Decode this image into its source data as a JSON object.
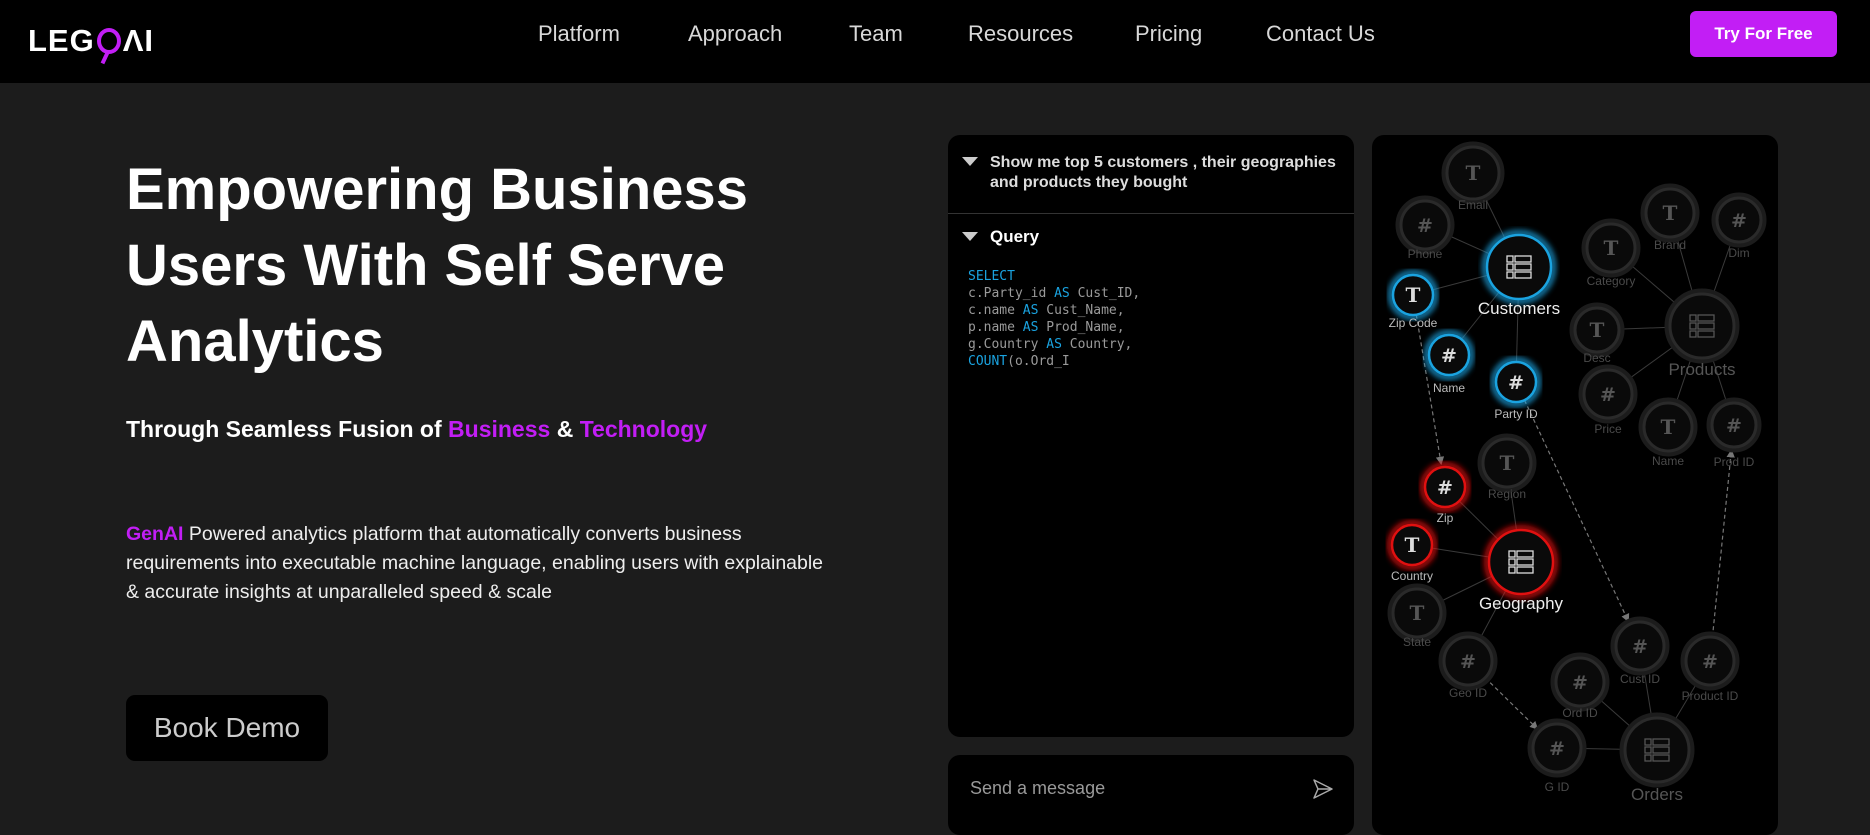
{
  "brand": {
    "logo_text": "LEGO AI",
    "accent": "#c21ef5"
  },
  "nav": {
    "items": [
      "Platform",
      "Approach",
      "Team",
      "Resources",
      "Pricing",
      "Contact Us"
    ],
    "cta": "Try For Free"
  },
  "hero": {
    "title": "Empowering Business Users With Self Serve Analytics",
    "subtitle_prefix": "Through Seamless Fusion of ",
    "subtitle_highlight1": "Business",
    "subtitle_amp": " & ",
    "subtitle_highlight2": "Technology",
    "para_highlight": "GenAI",
    "para_text": " Powered analytics platform that automatically converts business requirements into executable machine language, enabling users with explainable & accurate insights at unparalleled speed & scale",
    "book_demo": "Book Demo"
  },
  "chat": {
    "question": "Show me top 5 customers , their geographies and products they bought",
    "query_label": "Query",
    "sql": [
      [
        {
          "k": true,
          "t": "SELECT"
        }
      ],
      [
        {
          "t": "c.Party_id "
        },
        {
          "k": true,
          "t": "AS"
        },
        {
          "t": " Cust_ID,"
        }
      ],
      [
        {
          "t": "c.name "
        },
        {
          "k": true,
          "t": "AS"
        },
        {
          "t": " Cust_Name,"
        }
      ],
      [
        {
          "t": "p.name "
        },
        {
          "k": true,
          "t": "AS"
        },
        {
          "t": " Prod_Name,"
        }
      ],
      [
        {
          "t": "g.Country "
        },
        {
          "k": true,
          "t": "AS"
        },
        {
          "t": " Country,"
        }
      ],
      [
        {
          "k": true,
          "t": "COUNT"
        },
        {
          "t": "(o.Ord_I"
        }
      ]
    ],
    "input_placeholder": "Send a message"
  },
  "graph": {
    "colors": {
      "customers": "#1aa3e0",
      "geography": "#e01010",
      "inactive": "#2a2a2a"
    },
    "nodes": [
      {
        "id": "email",
        "label": "Email",
        "type": "T"
      },
      {
        "id": "phone",
        "label": "Phone",
        "type": "#"
      },
      {
        "id": "customers",
        "label": "Customers",
        "type": "table",
        "hl": "customers"
      },
      {
        "id": "zipcode",
        "label": "Zip Code",
        "type": "T",
        "hl": "customers"
      },
      {
        "id": "cname",
        "label": "Name",
        "type": "#",
        "hl": "customers"
      },
      {
        "id": "partyid",
        "label": "Party ID",
        "type": "#",
        "hl": "customers"
      },
      {
        "id": "category",
        "label": "Category",
        "type": "T"
      },
      {
        "id": "brand",
        "label": "Brand",
        "type": "T"
      },
      {
        "id": "dim",
        "label": "Dim",
        "type": "#"
      },
      {
        "id": "products",
        "label": "Products",
        "type": "table"
      },
      {
        "id": "desc",
        "label": "Desc",
        "type": "T"
      },
      {
        "id": "price",
        "label": "Price",
        "type": "#"
      },
      {
        "id": "pname",
        "label": "Name",
        "type": "T"
      },
      {
        "id": "prodid",
        "label": "Prod ID",
        "type": "#"
      },
      {
        "id": "region",
        "label": "Region",
        "type": "T"
      },
      {
        "id": "zip",
        "label": "Zip",
        "type": "#",
        "hl": "geography"
      },
      {
        "id": "country",
        "label": "Country",
        "type": "T",
        "hl": "geography"
      },
      {
        "id": "geography",
        "label": "Geography",
        "type": "table",
        "hl": "geography"
      },
      {
        "id": "state",
        "label": "State",
        "type": "T"
      },
      {
        "id": "geoid",
        "label": "Geo ID",
        "type": "#"
      },
      {
        "id": "custid",
        "label": "Cust ID",
        "type": "#"
      },
      {
        "id": "productid",
        "label": "Product ID",
        "type": "#"
      },
      {
        "id": "ordid",
        "label": "Ord ID",
        "type": "#"
      },
      {
        "id": "gid",
        "label": "G ID",
        "type": "#"
      },
      {
        "id": "orders",
        "label": "Orders",
        "type": "table"
      }
    ],
    "edges": [
      [
        "email",
        "customers"
      ],
      [
        "phone",
        "customers"
      ],
      [
        "zipcode",
        "customers"
      ],
      [
        "cname",
        "customers"
      ],
      [
        "partyid",
        "customers"
      ],
      [
        "category",
        "products"
      ],
      [
        "brand",
        "products"
      ],
      [
        "dim",
        "products"
      ],
      [
        "desc",
        "products"
      ],
      [
        "price",
        "products"
      ],
      [
        "pname",
        "products"
      ],
      [
        "prodid",
        "products"
      ],
      [
        "region",
        "geography"
      ],
      [
        "zip",
        "geography"
      ],
      [
        "country",
        "geography"
      ],
      [
        "state",
        "geography"
      ],
      [
        "geoid",
        "geography"
      ],
      [
        "ordid",
        "orders"
      ],
      [
        "custid",
        "orders"
      ],
      [
        "productid",
        "orders"
      ],
      [
        "gid",
        "orders"
      ]
    ],
    "links": [
      [
        "zipcode",
        "zip"
      ],
      [
        "partyid",
        "custid"
      ],
      [
        "productid",
        "prodid"
      ],
      [
        "geoid",
        "gid"
      ]
    ]
  }
}
